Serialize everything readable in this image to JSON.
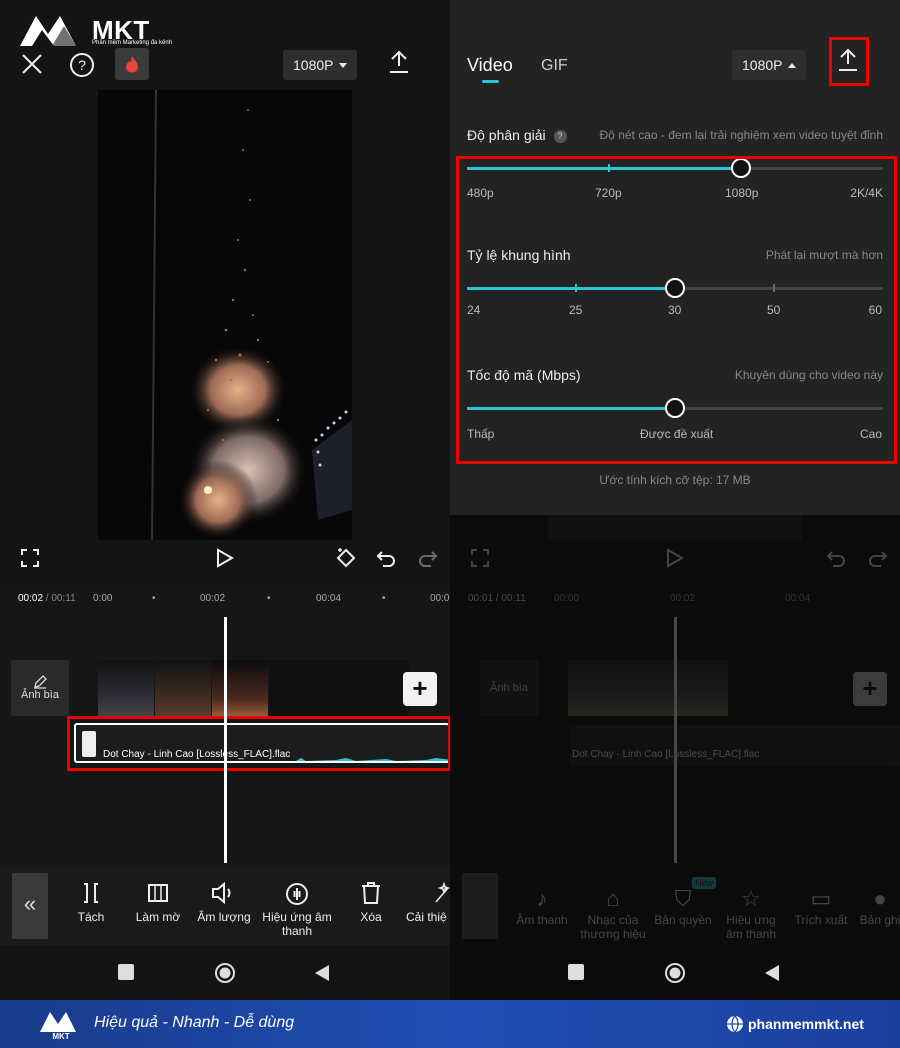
{
  "left": {
    "logo": {
      "text": "MKT",
      "tagline": "Phần mềm Marketing đa kênh"
    },
    "resolution_button": "1080P",
    "timecode": {
      "current": "00:02",
      "total": " / 00:11"
    },
    "ruler": [
      "0:00",
      "00:02",
      "00:04",
      "00:0"
    ],
    "cover_label": "Ảnh bìa",
    "audio_clip": "Dot Chay - Linh Cao [Lossless_FLAC].flac",
    "tools": [
      {
        "icon": "split-icon",
        "label": "Tách"
      },
      {
        "icon": "blur-icon",
        "label": "Làm mờ"
      },
      {
        "icon": "volume-icon",
        "label": "Âm lượng"
      },
      {
        "icon": "sound-effect-icon",
        "label": "Hiệu ứng âm thanh"
      },
      {
        "icon": "delete-icon",
        "label": "Xóa"
      },
      {
        "icon": "enhance-icon",
        "label": "Cải thiệ nó"
      }
    ]
  },
  "right": {
    "tabs": [
      "Video",
      "GIF"
    ],
    "active_tab": "Video",
    "resolution_button": "1080P",
    "resolution": {
      "title": "Độ phân giải",
      "hint": "Độ nét cao - đem lại trải nghiệm xem video tuyệt đỉnh",
      "options": [
        "480p",
        "720p",
        "1080p",
        "2K/4K"
      ],
      "selected": "1080p"
    },
    "framerate": {
      "title": "Tỷ lệ khung hình",
      "hint": "Phát lại mượt mà hơn",
      "options": [
        "24",
        "25",
        "30",
        "50",
        "60"
      ],
      "selected": "30"
    },
    "bitrate": {
      "title": "Tốc độ mã (Mbps)",
      "hint": "Khuyên dùng cho video này",
      "options": [
        "Thấp",
        "Được đề xuất",
        "Cao"
      ],
      "selected": "Được đề xuất"
    },
    "estimate": "Ước tính kích cỡ tệp: 17 MB",
    "timecode": {
      "current": "00:01",
      "total": " / 00:11"
    },
    "ruler": [
      "00:00",
      "00:02",
      "00:04"
    ],
    "cover_label": "Ảnh bìa",
    "audio_clip": "Dot Chay - Linh Cao [Lossless_FLAC].flac",
    "tools": [
      {
        "icon": "music-icon",
        "label": "Âm thanh"
      },
      {
        "icon": "brand-music-icon",
        "label": "Nhạc của thương hiệu"
      },
      {
        "icon": "copyright-icon",
        "label": "Bản quyền",
        "badge": "New"
      },
      {
        "icon": "effect-star-icon",
        "label": "Hiệu ứng âm thanh"
      },
      {
        "icon": "folder-icon",
        "label": "Trích xuất"
      },
      {
        "icon": "mic-icon",
        "label": "Bản ghi"
      }
    ]
  },
  "footer": {
    "slogan": "Hiệu quả - Nhanh - Dễ dùng",
    "website": "phanmemmkt.net"
  },
  "colors": {
    "accent": "#2ec6d6",
    "highlight": "#e00000",
    "footer": "#1f4fb5"
  }
}
